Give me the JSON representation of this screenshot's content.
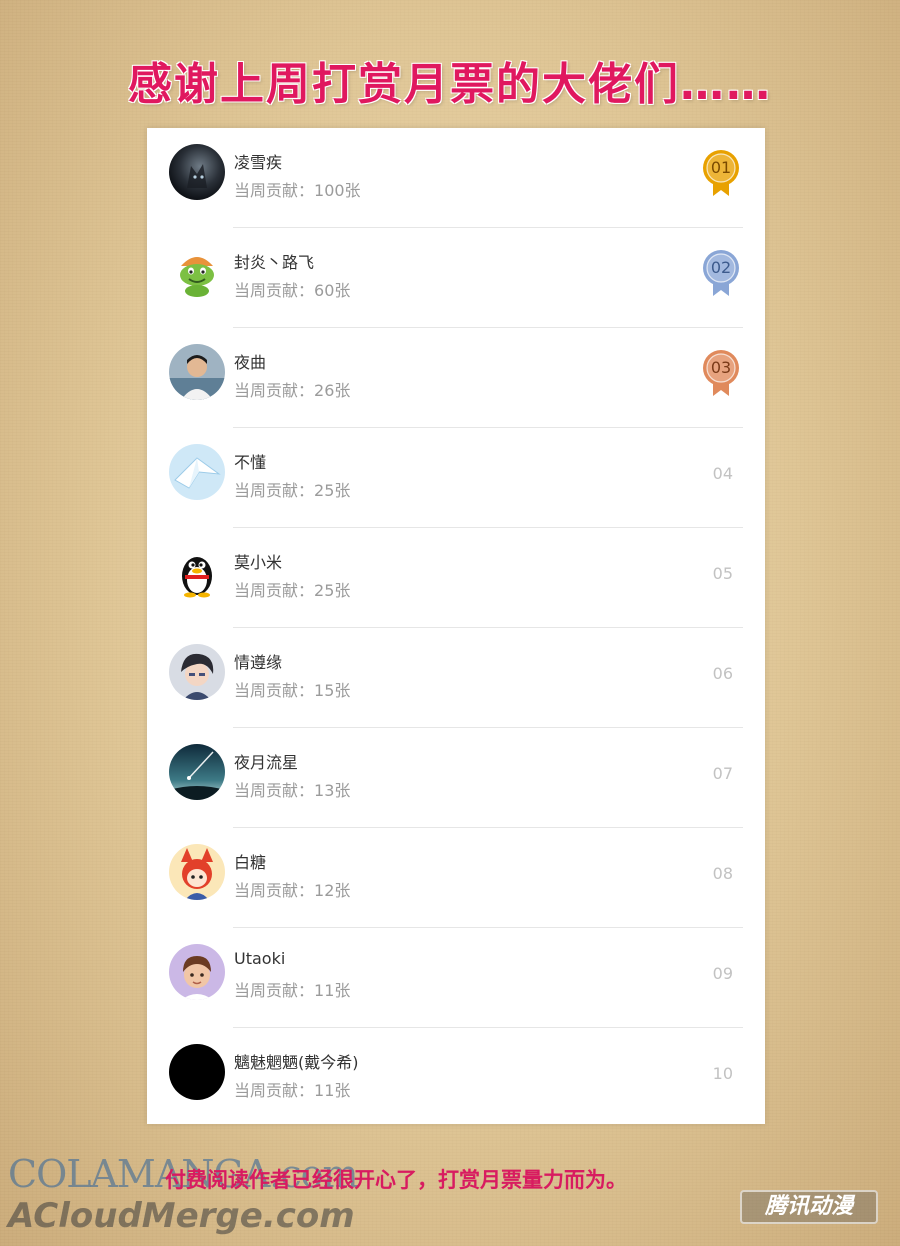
{
  "title": "感谢上周打赏月票的大佬们……",
  "contribution_label": "当周贡献：",
  "rankings": [
    {
      "rank": "01",
      "name": "凌雪疾",
      "contribution": "100张",
      "medal": "gold",
      "avatar": "dark-cat-avatar"
    },
    {
      "rank": "02",
      "name": "封炎丶路飞",
      "contribution": "60张",
      "medal": "silver",
      "avatar": "frog-avatar"
    },
    {
      "rank": "03",
      "name": "夜曲",
      "contribution": "26张",
      "medal": "bronze",
      "avatar": "boy-photo-avatar"
    },
    {
      "rank": "04",
      "name": "不懂",
      "contribution": "25张",
      "medal": null,
      "avatar": "paper-crane-avatar"
    },
    {
      "rank": "05",
      "name": "莫小米",
      "contribution": "25张",
      "medal": null,
      "avatar": "penguin-avatar"
    },
    {
      "rank": "06",
      "name": "情遵缘",
      "contribution": "15张",
      "medal": null,
      "avatar": "anime-boy-avatar"
    },
    {
      "rank": "07",
      "name": "夜月流星",
      "contribution": "13张",
      "medal": null,
      "avatar": "meteor-sky-avatar"
    },
    {
      "rank": "08",
      "name": "白糖",
      "contribution": "12张",
      "medal": null,
      "avatar": "fox-girl-avatar"
    },
    {
      "rank": "09",
      "name": "Utaoki",
      "contribution": "11张",
      "medal": null,
      "avatar": "cartoon-boy-avatar"
    },
    {
      "rank": "10",
      "name": "魑魅魍魉(戴今希)",
      "contribution": "11张",
      "medal": null,
      "avatar": "black-avatar"
    }
  ],
  "medal_colors": {
    "gold": "#e8a100",
    "silver": "#8aa6d6",
    "bronze": "#e08a5c"
  },
  "footer_note": "付费阅读作者已经很开心了，打赏月票量力而为。",
  "watermarks": {
    "colamanga": "COLAMANGA.com",
    "acloudmerge": "ACloudMerge.com",
    "logo": "腾讯动漫"
  }
}
